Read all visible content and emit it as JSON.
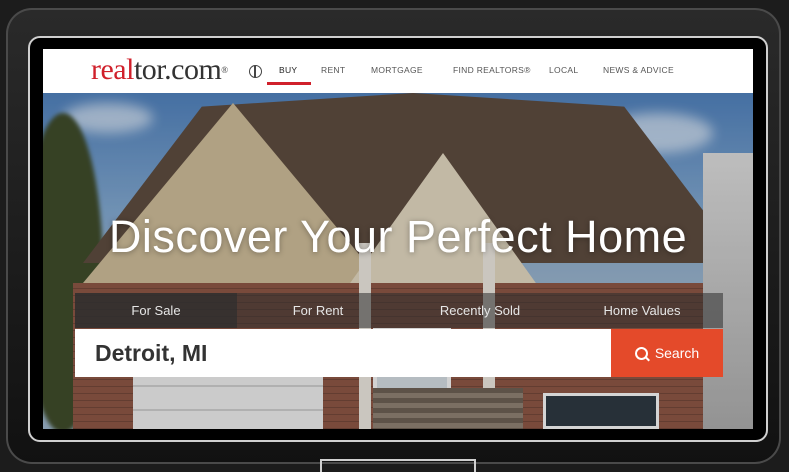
{
  "logo": {
    "part1": "real",
    "part2": "tor.com",
    "mark": "®"
  },
  "nav": {
    "items": [
      {
        "label": "BUY",
        "active": true
      },
      {
        "label": "RENT",
        "active": false
      },
      {
        "label": "MORTGAGE",
        "active": false
      },
      {
        "label": "FIND REALTORS®",
        "active": false
      },
      {
        "label": "LOCAL",
        "active": false
      },
      {
        "label": "NEWS & ADVICE",
        "active": false
      }
    ],
    "globe_icon": "globe-icon"
  },
  "hero": {
    "title": "Discover Your Perfect Home",
    "tabs": [
      "For Sale",
      "For Rent",
      "Recently Sold",
      "Home Values"
    ],
    "active_tab": 0,
    "search": {
      "value": "Detroit, MI",
      "button_label": "Search",
      "button_icon": "search-icon"
    }
  },
  "colors": {
    "brand_red": "#d0202b",
    "search_button": "#e44a2a"
  }
}
